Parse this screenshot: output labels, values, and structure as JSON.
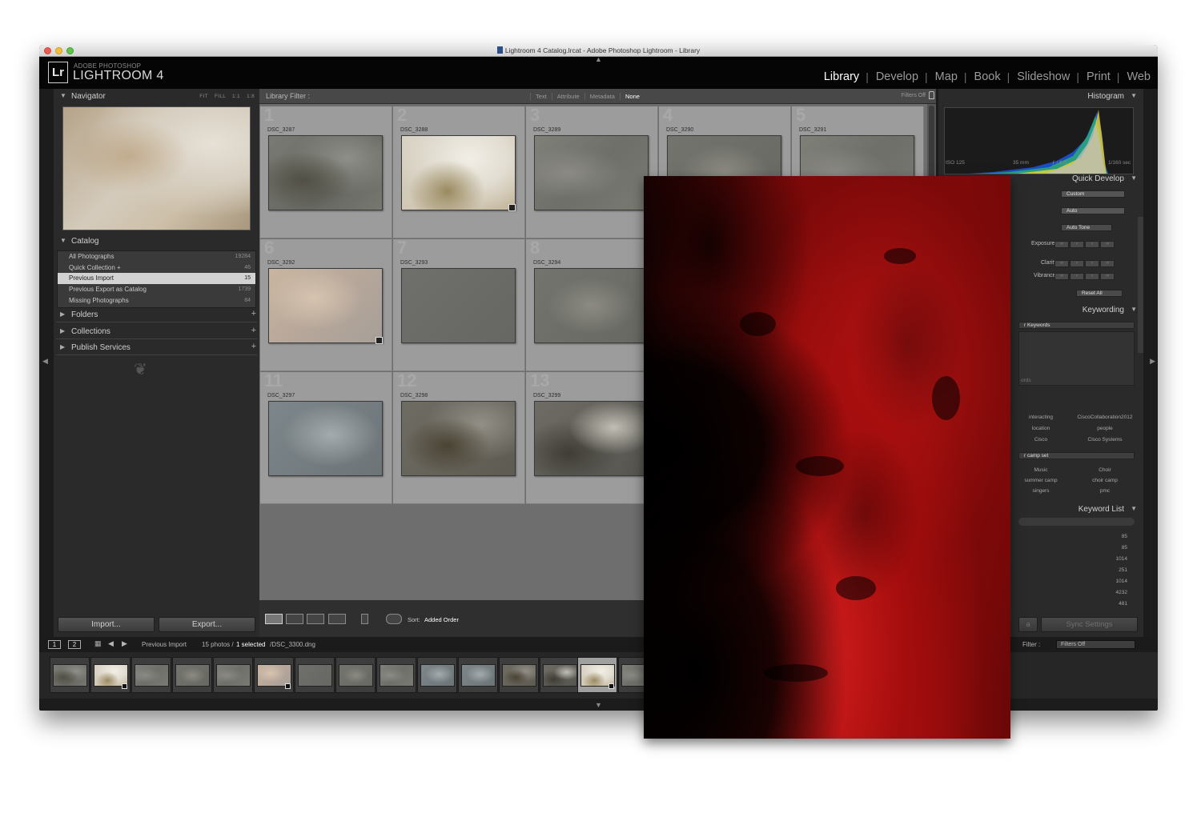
{
  "window": {
    "title": "Lightroom 4 Catalog.lrcat - Adobe Photoshop Lightroom - Library"
  },
  "identity": {
    "logo": "Lr",
    "brand_top": "ADOBE PHOTOSHOP",
    "brand_main": "LIGHTROOM 4"
  },
  "modules": [
    "Library",
    "Develop",
    "Map",
    "Book",
    "Slideshow",
    "Print",
    "Web"
  ],
  "active_module": "Library",
  "left_panel": {
    "navigator": {
      "label": "Navigator",
      "zoom_options": [
        "FIT",
        "FILL",
        "1:1",
        "1:8"
      ]
    },
    "catalog": {
      "label": "Catalog",
      "items": [
        {
          "label": "All Photographs",
          "count": "19284"
        },
        {
          "label": "Quick Collection +",
          "count": "46"
        },
        {
          "label": "Previous Import",
          "count": "15"
        },
        {
          "label": "Previous Export as Catalog",
          "count": "1739"
        },
        {
          "label": "Missing Photographs",
          "count": "84"
        }
      ],
      "selected": "Previous Import"
    },
    "folders": {
      "label": "Folders"
    },
    "collections": {
      "label": "Collections"
    },
    "publish": {
      "label": "Publish Services"
    },
    "import_label": "Import...",
    "export_label": "Export..."
  },
  "library_filter": {
    "label": "Library Filter :",
    "options": [
      "Text",
      "Attribute",
      "Metadata",
      "None"
    ],
    "active": "None",
    "status": "Filters Off"
  },
  "grid": {
    "cells": [
      {
        "index": "1",
        "filename": "DSC_3287"
      },
      {
        "index": "2",
        "filename": "DSC_3288"
      },
      {
        "index": "3",
        "filename": "DSC_3289"
      },
      {
        "index": "4",
        "filename": "DSC_3290"
      },
      {
        "index": "5",
        "filename": "DSC_3291"
      },
      {
        "index": "6",
        "filename": "DSC_3292"
      },
      {
        "index": "7",
        "filename": "DSC_3293"
      },
      {
        "index": "8",
        "filename": "DSC_3294"
      },
      {
        "index": "11",
        "filename": "DSC_3297"
      },
      {
        "index": "12",
        "filename": "DSC_3298"
      },
      {
        "index": "13",
        "filename": "DSC_3299"
      }
    ]
  },
  "toolbar": {
    "sort_label": "Sort:",
    "sort_value": "Added Order"
  },
  "right_panel": {
    "histogram": {
      "label": "Histogram",
      "iso": "ISO 125",
      "focal": "35 mm",
      "aperture": "ƒ / 6.0",
      "shutter": "1/160 sec"
    },
    "quick_develop": {
      "label": "Quick Develop",
      "preset": "Custom",
      "white_balance": "Auto",
      "auto_tone": "Auto Tone",
      "exposure": "Exposure",
      "clarity": "Clarity",
      "vibrance": "Vibrance",
      "reset": "Reset All"
    },
    "keywording": {
      "label": "Keywording",
      "tags_field": "r Keywords",
      "hint": "ords",
      "suggestions": [
        [
          "interacting",
          "CiscoCollaboration2012"
        ],
        [
          "location",
          "people"
        ],
        [
          "Cisco",
          "Cisco Systems"
        ]
      ],
      "set_name": "r camp set",
      "set_items": [
        [
          "Music",
          "Choir"
        ],
        [
          "summer camp",
          "choir camp"
        ],
        [
          "singers",
          "pmc"
        ]
      ]
    },
    "keyword_list": {
      "label": "Keyword List",
      "counts": [
        "85",
        "85",
        "1014",
        "251",
        "1014",
        "4232",
        "481"
      ]
    },
    "sync_label": "Sync Settings",
    "sync_meta_fragment": "a"
  },
  "filmstrip": {
    "page1": "1",
    "page2": "2",
    "source": "Previous Import",
    "count_text": "15 photos /",
    "selected_text": "1 selected",
    "file_text": "/DSC_3300.dng",
    "filter_label": "Filter :",
    "filter_value": "Filters Off"
  },
  "colors": {
    "overlay_red": "#c41515",
    "panel_bg": "#2a2a2a",
    "grid_bg": "#9c9c9c"
  }
}
